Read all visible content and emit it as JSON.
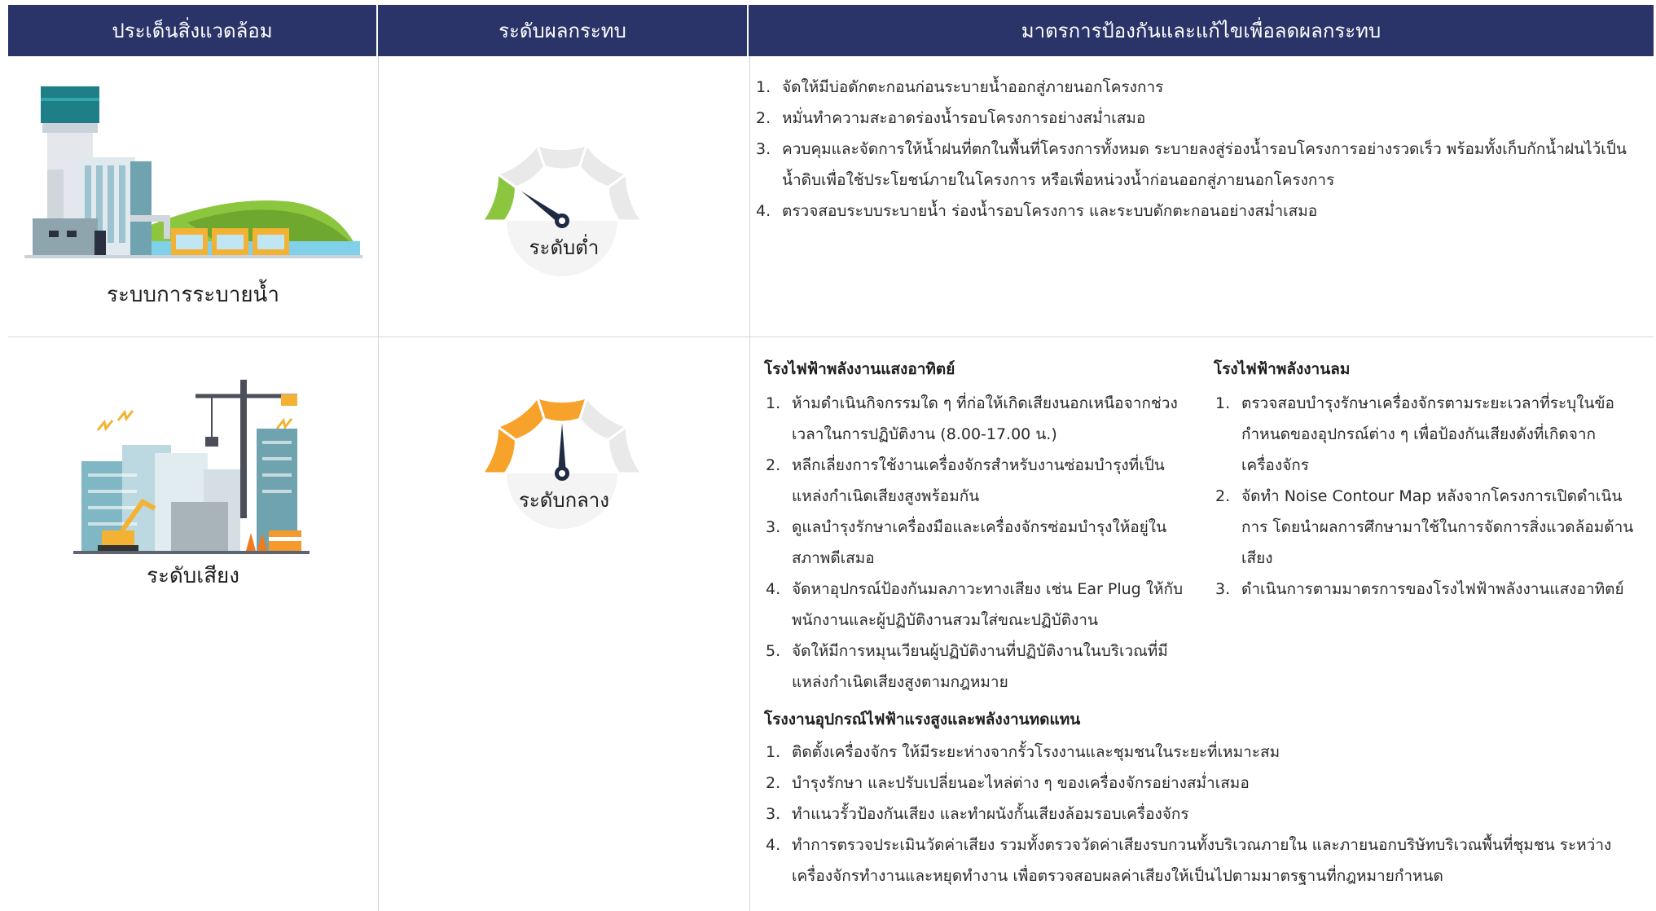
{
  "header": {
    "col1": "ประเด็นสิ่งแวดล้อม",
    "col2": "ระดับผลกระทบ",
    "col3": "มาตรการป้องกันและแก้ไขเพื่อลดผลกระทบ"
  },
  "rows": [
    {
      "issue": "ระบบการระบายน้ำ",
      "level": "ระดับต่ำ",
      "gauge_level_fraction": 0.2,
      "colors": {
        "active": "#8cc63f",
        "inactive": "#e9e9e9",
        "needle": "#1f2a44"
      },
      "measures": [
        {
          "num": "1.",
          "text": "จัดให้มีบ่อดักตะกอนก่อนระบายน้ำออกสู่ภายนอกโครงการ"
        },
        {
          "num": "2.",
          "text": "หมั่นทำความสะอาดร่องน้ำรอบโครงการอย่างสม่ำเสมอ"
        },
        {
          "num": "3.",
          "text": "ควบคุมและจัดการให้น้ำฝนที่ตกในพื้นที่โครงการทั้งหมด ระบายลงสู่ร่องน้ำรอบโครงการอย่างรวดเร็ว พร้อมทั้งเก็บกักน้ำฝนไว้เป็นน้ำดิบเพื่อใช้ประโยชน์ภายในโครงการ หรือเพื่อหน่วงน้ำก่อนออกสู่ภายนอกโครงการ"
        },
        {
          "num": "4.",
          "text": "ตรวจสอบระบบระบายน้ำ ร่องน้ำรอบโครงการ และระบบดักตะกอนอย่างสม่ำเสมอ"
        }
      ]
    },
    {
      "issue": "ระดับเสียง",
      "level": "ระดับกลาง",
      "gauge_level_fraction": 0.5,
      "colors": {
        "active": "#f7a22b",
        "inactive": "#e9e9e9",
        "needle": "#1f2a44"
      },
      "groups": [
        {
          "title": "โรงไฟฟ้าพลังงานแสงอาทิตย์",
          "items": [
            {
              "num": "1.",
              "text": "ห้ามดำเนินกิจกรรมใด ๆ ที่ก่อให้เกิดเสียงนอกเหนือจากช่วงเวลาในการปฏิบัติงาน (8.00-17.00 น.)"
            },
            {
              "num": "2.",
              "text": "หลีกเลี่ยงการใช้งานเครื่องจักรสำหรับงานซ่อมบำรุงที่เป็นแหล่งกำเนิดเสียงสูงพร้อมกัน"
            },
            {
              "num": "3.",
              "text": "ดูแลบำรุงรักษาเครื่องมือและเครื่องจักรซ่อมบำรุงให้อยู่ในสภาพดีเสมอ"
            },
            {
              "num": "4.",
              "text": "จัดหาอุปกรณ์ป้องกันมลภาวะทางเสียง เช่น Ear Plug ให้กับพนักงานและผู้ปฏิบัติงานสวมใส่ขณะปฏิบัติงาน"
            },
            {
              "num": "5.",
              "text": "จัดให้มีการหมุนเวียนผู้ปฏิบัติงานที่ปฏิบัติงานในบริเวณที่มีแหล่งกำเนิดเสียงสูงตามกฎหมาย"
            }
          ]
        },
        {
          "title": "โรงไฟฟ้าพลังงานลม",
          "items": [
            {
              "num": "1.",
              "text": "ตรวจสอบบำรุงรักษาเครื่องจักรตามระยะเวลาที่ระบุในข้อกำหนดของอุปกรณ์ต่าง ๆ เพื่อป้องกันเสียงดังที่เกิดจากเครื่องจักร"
            },
            {
              "num": "2.",
              "text": "จัดทำ Noise Contour Map หลังจากโครงการเปิดดำเนินการ โดยนำผลการศึกษามาใช้ในการจัดการสิ่งแวดล้อมด้านเสียง"
            },
            {
              "num": "3.",
              "text": "ดำเนินการตามมาตรการของโรงไฟฟ้าพลังงานแสงอาทิตย์"
            }
          ]
        },
        {
          "title": "โรงงานอุปกรณ์ไฟฟ้าแรงสูงและพลังงานทดแทน",
          "items": [
            {
              "num": "1.",
              "text": "ติดตั้งเครื่องจักร ให้มีระยะห่างจากรั้วโรงงานและชุมชนในระยะที่เหมาะสม"
            },
            {
              "num": "2.",
              "text": "บำรุงรักษา และปรับเปลี่ยนอะไหล่ต่าง ๆ ของเครื่องจักรอย่างสม่ำเสมอ"
            },
            {
              "num": "3.",
              "text": "ทำแนวรั้วป้องกันเสียง และทำผนังกั้นเสียงล้อมรอบเครื่องจักร"
            },
            {
              "num": "4.",
              "text": "ทำการตรวจประเมินวัดค่าเสียง รวมทั้งตรวจวัดค่าเสียงรบกวนทั้งบริเวณภายใน และภายนอกบริษัทบริเวณพื้นที่ชุมชน ระหว่างเครื่องจักรทำงานและหยุดทำงาน เพื่อตรวจสอบผลค่าเสียงให้เป็นไปตามมาตรฐานที่กฎหมายกำหนด"
            }
          ]
        }
      ]
    }
  ]
}
